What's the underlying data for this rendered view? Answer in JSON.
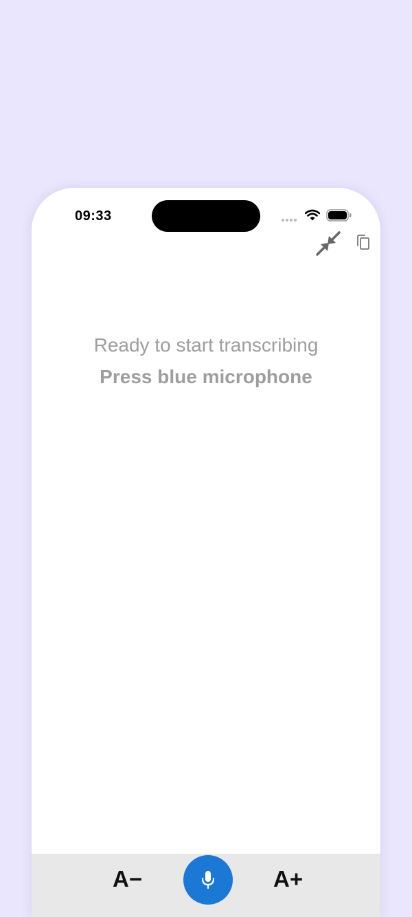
{
  "status_bar": {
    "time": "09:33"
  },
  "toolbar": {
    "collapse_icon": "collapse-arrows-icon",
    "copy_icon": "copy-icon"
  },
  "main": {
    "ready_text": "Ready to start transcribing",
    "instruction_text": "Press blue microphone"
  },
  "bottom_bar": {
    "decrease_font_label": "A−",
    "increase_font_label": "A+",
    "mic_icon": "microphone-icon"
  },
  "colors": {
    "background": "#EAE6FD",
    "phone_surface": "#FFFFFF",
    "hint_text": "#9E9E9E",
    "mic_button": "#1B79D5",
    "bottom_bar": "#E8E8E8"
  }
}
